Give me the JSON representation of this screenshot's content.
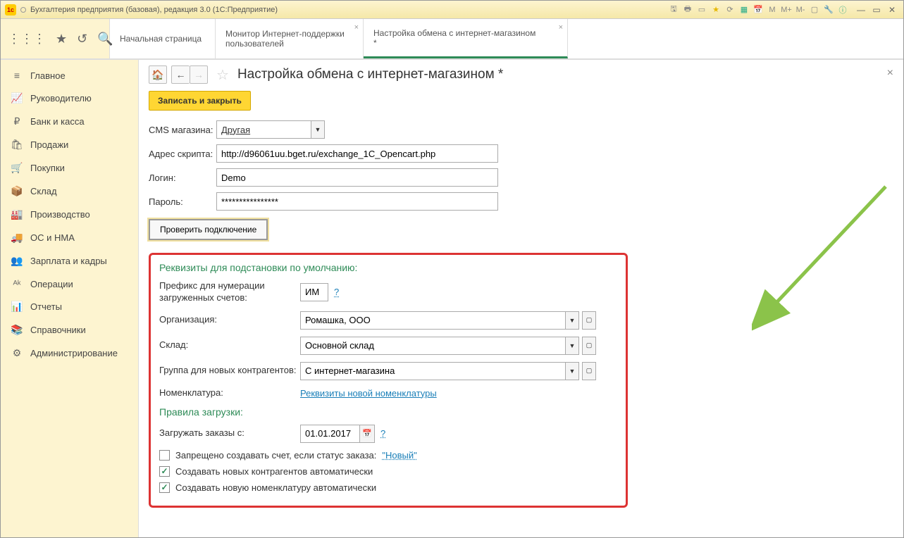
{
  "titlebar": {
    "app_title": "Бухгалтерия предприятия (базовая), редакция 3.0  (1С:Предприятие)"
  },
  "tabs": {
    "home": "Начальная страница",
    "monitor_l1": "Монитор Интернет-поддержки",
    "monitor_l2": "пользователей",
    "exchange_l1": "Настройка обмена с интернет-магазином",
    "exchange_l2": "*"
  },
  "sidebar": {
    "items": [
      "Главное",
      "Руководителю",
      "Банк и касса",
      "Продажи",
      "Покупки",
      "Склад",
      "Производство",
      "ОС и НМА",
      "Зарплата и кадры",
      "Операции",
      "Отчеты",
      "Справочники",
      "Администрирование"
    ]
  },
  "page": {
    "title": "Настройка обмена с интернет-магазином *",
    "save_close": "Записать и закрыть",
    "cms_label": "CMS магазина:",
    "cms_value": "Другая",
    "script_label": "Адрес скрипта:",
    "script_value": "http://d96061uu.bget.ru/exchange_1C_Opencart.php",
    "login_label": "Логин:",
    "login_value": "Demo",
    "password_label": "Пароль:",
    "password_value": "****************",
    "check_conn": "Проверить подключение",
    "section_defaults": "Реквизиты для подстановки по умолчанию:",
    "prefix_label_l1": "Префикс для нумерации",
    "prefix_label_l2": "загруженных счетов:",
    "prefix_value": "ИМ",
    "qmark": "?",
    "org_label": "Организация:",
    "org_value": "Ромашка, ООО",
    "warehouse_label": "Склад:",
    "warehouse_value": "Основной склад",
    "group_label": "Группа для новых контрагентов:",
    "group_value": "С интернет-магазина",
    "nomen_label": "Номенклатура:",
    "nomen_link": "Реквизиты новой номенклатуры",
    "section_rules": "Правила загрузки:",
    "load_from_label": "Загружать заказы с:",
    "load_from_value": "01.01.2017",
    "cb_forbid": "Запрещено создавать счет, если статус заказа:",
    "status_link": "\"Новый\"",
    "cb_auto_contr": "Создавать новых контрагентов автоматически",
    "cb_auto_nomen": "Создавать новую номенклатуру автоматически"
  }
}
